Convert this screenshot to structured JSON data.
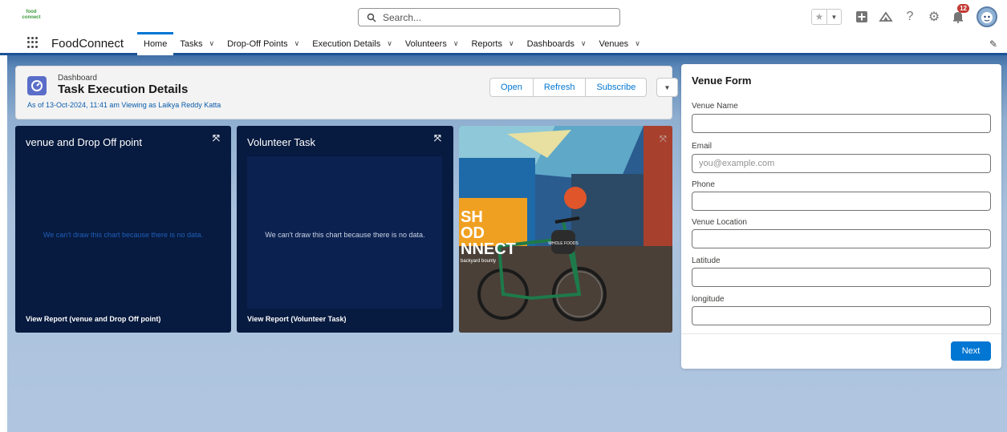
{
  "header": {
    "logo_text": "food connect",
    "search_placeholder": "Search...",
    "notification_count": "12"
  },
  "nav": {
    "app_name": "FoodConnect",
    "items": [
      {
        "label": "Home",
        "active": true,
        "has_menu": false
      },
      {
        "label": "Tasks",
        "has_menu": true
      },
      {
        "label": "Drop-Off Points",
        "has_menu": true
      },
      {
        "label": "Execution Details",
        "has_menu": true
      },
      {
        "label": "Volunteers",
        "has_menu": true
      },
      {
        "label": "Reports",
        "has_menu": true
      },
      {
        "label": "Dashboards",
        "has_menu": true
      },
      {
        "label": "Venues",
        "has_menu": true
      }
    ]
  },
  "dashboard": {
    "label": "Dashboard",
    "title": "Task Execution Details",
    "meta": "As of 13-Oct-2024, 11:41 am Viewing as Laikya Reddy Katta",
    "buttons": {
      "open": "Open",
      "refresh": "Refresh",
      "subscribe": "Subscribe"
    }
  },
  "cards": [
    {
      "title": "venue and Drop Off point",
      "message": "We can't draw this chart because there is no data.",
      "footer": "View Report (venue and Drop Off point)"
    },
    {
      "title": "Volunteer Task",
      "message": "We can't draw this chart because there is no data.",
      "footer": "View Report (Volunteer Task)"
    }
  ],
  "image_card": {
    "sign_text": [
      "SH",
      "OD",
      "NNECT"
    ],
    "sub_text": "backyard bounty",
    "shop_sign": "WHOLE FOODS"
  },
  "venue_form": {
    "title": "Venue Form",
    "fields": [
      {
        "label": "Venue Name",
        "placeholder": ""
      },
      {
        "label": "Email",
        "placeholder": "you@example.com"
      },
      {
        "label": "Phone",
        "placeholder": ""
      },
      {
        "label": "Venue Location",
        "placeholder": ""
      },
      {
        "label": "Latitude",
        "placeholder": ""
      },
      {
        "label": "longitude",
        "placeholder": ""
      }
    ],
    "next_label": "Next"
  },
  "colors": {
    "brand": "#0176d3",
    "nav_border": "#1b5297",
    "card_bg": "#071a3f",
    "badge": "#c23934",
    "dashboard_icon": "#5a6ec9"
  }
}
